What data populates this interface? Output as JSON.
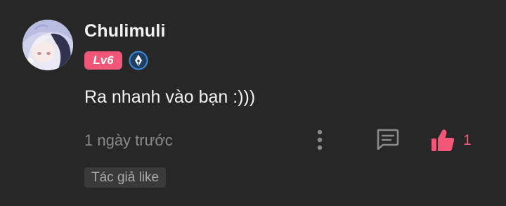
{
  "comment": {
    "username": "Chulimuli",
    "level_badge": "Lv6",
    "content": "Ra nhanh vào bạn :)))",
    "timestamp": "1 ngày trước",
    "like_count": "1",
    "author_like_tag": "Tác giả like"
  },
  "icons": {
    "avatar": "anime-girl-avatar",
    "pen_badge": "pen-nib-icon",
    "more": "vertical-dots-icon",
    "reply": "comment-bubble-icon",
    "like": "thumbs-up-icon"
  },
  "colors": {
    "background": "#272727",
    "accent": "#f25779",
    "pen_badge": "#3d8bd8"
  }
}
